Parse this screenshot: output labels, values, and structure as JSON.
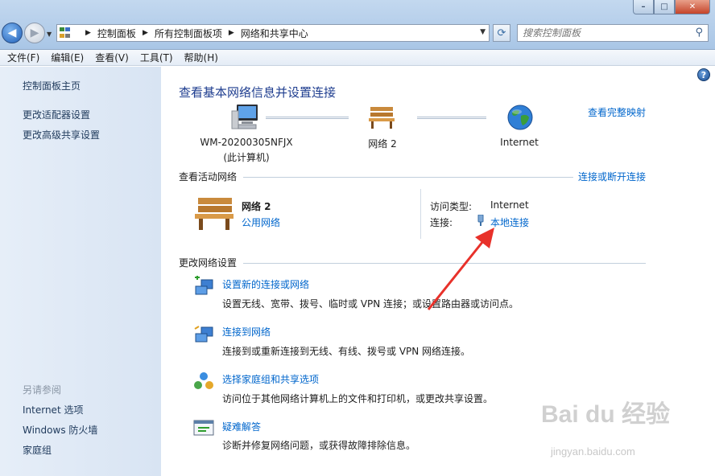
{
  "window": {
    "min": "–",
    "max": "□",
    "close": "✕"
  },
  "nav": {
    "back_icon": "back-arrow-icon",
    "forward_icon": "forward-arrow-icon"
  },
  "address": {
    "crumbs": [
      "控制面板",
      "所有控制面板项",
      "网络和共享中心"
    ]
  },
  "search": {
    "placeholder": "搜索控制面板"
  },
  "menu": [
    "文件(F)",
    "编辑(E)",
    "查看(V)",
    "工具(T)",
    "帮助(H)"
  ],
  "sidebar": {
    "items": [
      "控制面板主页",
      "更改适配器设置",
      "更改高级共享设置"
    ],
    "see_also_header": "另请参阅",
    "see_also": [
      "Internet 选项",
      "Windows 防火墙",
      "家庭组"
    ]
  },
  "main": {
    "title": "查看基本网络信息并设置连接",
    "full_map": "查看完整映射",
    "map": {
      "computer": "WM-20200305NFJX",
      "computer_sub": "(此计算机)",
      "network": "网络  2",
      "internet": "Internet"
    },
    "active": {
      "header": "查看活动网络",
      "connect_link": "连接或断开连接",
      "network_name": "网络  2",
      "network_type": "公用网络",
      "access_type_label": "访问类型:",
      "access_type_value": "Internet",
      "connection_label": "连接:",
      "connection_value": "本地连接"
    },
    "change": {
      "header": "更改网络设置",
      "tasks": [
        {
          "title": "设置新的连接或网络",
          "desc": "设置无线、宽带、拨号、临时或 VPN 连接；或设置路由器或访问点。"
        },
        {
          "title": "连接到网络",
          "desc": "连接到或重新连接到无线、有线、拨号或 VPN 网络连接。"
        },
        {
          "title": "选择家庭组和共享选项",
          "desc": "访问位于其他网络计算机上的文件和打印机，或更改共享设置。"
        },
        {
          "title": "疑难解答",
          "desc": "诊断并修复网络问题，或获得故障排除信息。"
        }
      ]
    }
  },
  "watermark": {
    "main": "Bai du 经验",
    "sub": "jingyan.baidu.com"
  },
  "colors": {
    "link": "#0066cc",
    "title": "#1e3d8f",
    "annotation_arrow": "#e8312a"
  }
}
